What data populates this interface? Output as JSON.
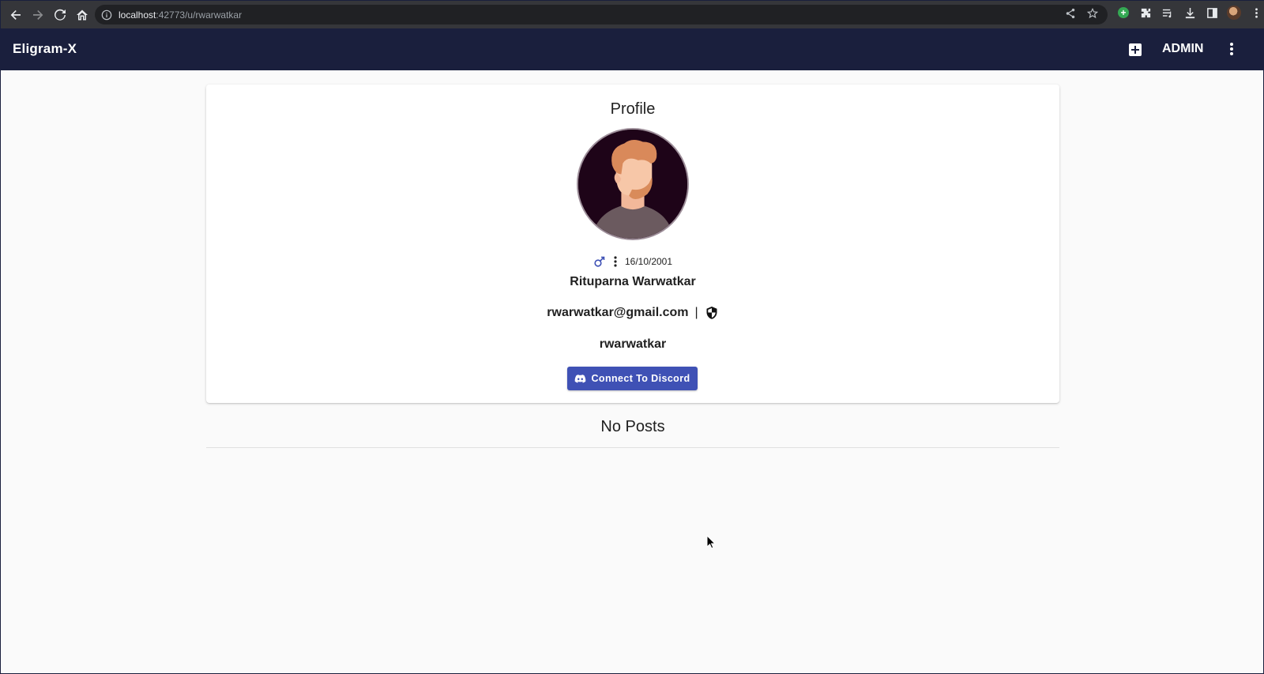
{
  "browser": {
    "url_host": "localhost",
    "url_path": ":42773/u/rwarwatkar"
  },
  "app_bar": {
    "title": "Eligram-X",
    "user_label": "ADMIN"
  },
  "profile": {
    "heading": "Profile",
    "dob": "16/10/2001",
    "full_name": "Rituparna Warwatkar",
    "email": "rwarwatkar@gmail.com",
    "separator": "|",
    "username": "rwarwatkar",
    "discord_button_label": "Connect To Discord"
  },
  "posts": {
    "empty_label": "No Posts"
  },
  "colors": {
    "app_bar": "#1a1f3d",
    "primary": "#3f51b5",
    "avatar_bg": "#1e0418"
  }
}
